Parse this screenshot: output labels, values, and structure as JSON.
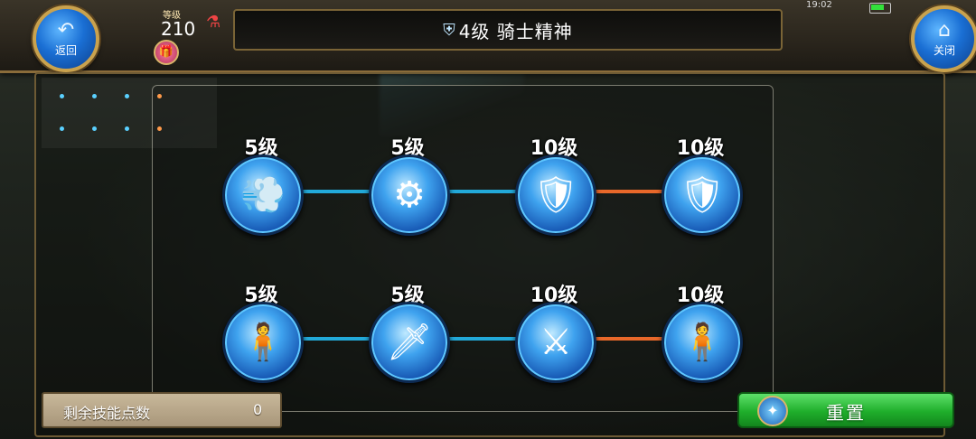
{
  "header": {
    "back_label": "返回",
    "close_label": "关闭",
    "level_caption": "等级",
    "level_value": "210",
    "title": "4级  骑士精神",
    "time": "19:02"
  },
  "tree": {
    "row1": [
      {
        "level": "5级",
        "icon": "speed-dash-icon",
        "glyph": "💨"
      },
      {
        "level": "5级",
        "icon": "gear-arrow-icon",
        "glyph": "⚙"
      },
      {
        "level": "10级",
        "icon": "shield-sparkle-icon",
        "glyph": "🛡"
      },
      {
        "level": "10级",
        "icon": "gold-shield-icon",
        "glyph": "🛡"
      }
    ],
    "row2": [
      {
        "level": "5级",
        "icon": "purple-figure-icon",
        "glyph": "🧍"
      },
      {
        "level": "5级",
        "icon": "flaming-sword-icon",
        "glyph": "🗡"
      },
      {
        "level": "10级",
        "icon": "sword-slash-icon",
        "glyph": "⚔"
      },
      {
        "level": "10级",
        "icon": "cyan-figure-icon",
        "glyph": "🧍"
      }
    ],
    "links_row1": [
      "blue",
      "blue",
      "orange"
    ],
    "links_row2": [
      "blue",
      "blue",
      "orange"
    ]
  },
  "footer": {
    "points_label": "剩余技能点数",
    "points_value": "0",
    "reset_label": "重置"
  },
  "colors": {
    "link_blue": "#22a9d9",
    "link_orange": "#e8682a",
    "reset_green": "#1fae2b"
  }
}
